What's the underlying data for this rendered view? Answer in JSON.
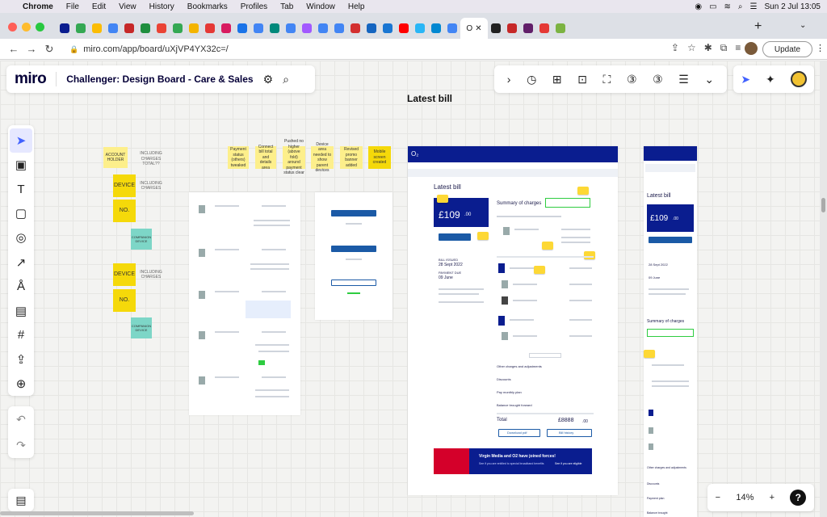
{
  "macbar": {
    "app": "Chrome",
    "menus": [
      "File",
      "Edit",
      "View",
      "History",
      "Bookmarks",
      "Profiles",
      "Tab",
      "Window",
      "Help"
    ],
    "clock": "Sun 2 Jul  13:05"
  },
  "browser": {
    "active_tab_label": "O",
    "url": "miro.com/app/board/uXjVP4YX32c=/",
    "update_label": "Update"
  },
  "board": {
    "logo": "miro",
    "title": "Challenger: Design Board - Care & Sales",
    "frame_title": "Latest bill",
    "zoom": "14%"
  },
  "stickies": {
    "account_holder": "ACCOUNT HOLDER",
    "including_charges": "INCLUDING CHARGES TOTAL??",
    "device_1": "DEVICE",
    "including_1": "INCLUDING CHARGES",
    "no_1": "NO.",
    "companion_1": "COMPANION DEVICE",
    "device_2": "DEVICE",
    "including_2": "INCLUDING CHARGES",
    "no_2": "NO.",
    "companion_2": "COMPANION DEVICE",
    "note_1": "Payment status (others) tweaked",
    "note_2": "Connect bill total and details area",
    "note_3": "Pushed no higher (above fold) around payment status clear",
    "note_4": "Device area needed to show parent devices",
    "note_5": "Revised promo banner added",
    "note_6": "Mobile screen created"
  },
  "desktop_mock": {
    "heading": "Latest bill",
    "amount": "£109",
    "amount_pence": ".00",
    "summary_heading": "Summary of charges",
    "pay_btn": "Pay bill",
    "bill_issued_label": "BILL ISSUED",
    "bill_issued_value": "28 Sept 2022",
    "payment_due_label": "PAYMENT DUE",
    "payment_due_value": "09 June",
    "other_charges": "Other charges and adjustments",
    "discounts": "Discounts",
    "pay_plans": "Pay monthly plan",
    "balance": "Balance brought forward",
    "total_label": "Total",
    "total_value": "£8888",
    "total_pence": ".00",
    "download_btn": "Download pdf",
    "bill_history_btn": "Bill history",
    "promo_title": "Virgin Media and O2 have joined forces!",
    "promo_sub": "See if you are entitled to special broadband benefits",
    "promo_cta": "See if you are eligible",
    "brand": "O₂"
  },
  "mobile_mock": {
    "heading": "Latest bill",
    "amount": "£109",
    "amount_pence": ".00",
    "pay_btn": "Pay bill",
    "bill_issued": "28 Sept 2022",
    "payment_due": "09 June",
    "summary_heading": "Summary of charges",
    "other_charges": "Other charges and adjustments",
    "discounts": "Discounts",
    "payment_plan": "Payment plan",
    "balance": "Balance brought"
  },
  "list_card_labels": {
    "pay_bill": "Pay bill",
    "view_bill": "View bill"
  },
  "colors": {
    "brand_blue": "#0a1d8f",
    "sticky_yellow": "#fdef8b",
    "sticky_gold": "#f5d90a",
    "sticky_teal": "#7dd6c7",
    "promo_red": "#d4002a"
  }
}
